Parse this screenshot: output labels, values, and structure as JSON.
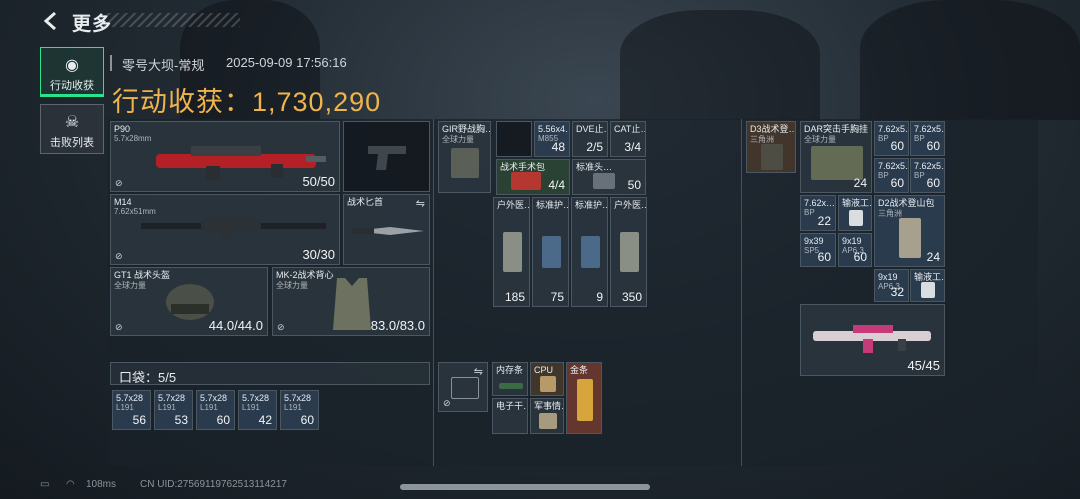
{
  "header": {
    "title": "更多"
  },
  "tabs": [
    {
      "label": "行动收获",
      "active": true,
      "icon": "loot-bag-icon"
    },
    {
      "label": "击败列表",
      "active": false,
      "icon": "skull-icon"
    }
  ],
  "raid": {
    "map": "零号大坝-常规",
    "datetime": "2025-09-09 17:56:16"
  },
  "harvest": {
    "label": "行动收获：",
    "value": "1,730,290"
  },
  "equipment": {
    "primary": {
      "name": "P90",
      "caliber": "5.7x28mm",
      "ammo": "50/50"
    },
    "secondary": {
      "name": "M14",
      "caliber": "7.62x51mm",
      "ammo": "30/30"
    },
    "pistol": {
      "name": ""
    },
    "melee": {
      "name": "战术匕首"
    },
    "helmet": {
      "name": "GT1 战术头盔",
      "brand": "全球力量",
      "durability": "44.0/44.0"
    },
    "armor": {
      "name": "MK-2战术背心",
      "brand": "全球力量",
      "durability": "83.0/83.0"
    }
  },
  "pockets": {
    "label": "口袋：5/5",
    "items": [
      {
        "name": "5.7x28",
        "sub": "L191",
        "count": "56"
      },
      {
        "name": "5.7x28",
        "sub": "L191",
        "count": "53"
      },
      {
        "name": "5.7x28",
        "sub": "L191",
        "count": "60"
      },
      {
        "name": "5.7x28",
        "sub": "L191",
        "count": "42"
      },
      {
        "name": "5.7x28",
        "sub": "L191",
        "count": "60"
      }
    ]
  },
  "chest_rig": {
    "name": "GIR野战胸…",
    "brand": "全球力量",
    "items": [
      {
        "name": "5.56x4…",
        "sub": "M855",
        "count": "48"
      },
      {
        "name": "DVE止…",
        "count": "2/5"
      },
      {
        "name": "CAT止…",
        "count": "3/4"
      },
      {
        "name": "战术手术包",
        "count": "4/4"
      },
      {
        "name": "标准头…",
        "count": "50"
      },
      {
        "name": "户外医…",
        "count": "185"
      },
      {
        "name": "标准护…",
        "count": "75"
      },
      {
        "name": "标准护…",
        "count": "9"
      },
      {
        "name": "户外医…",
        "count": "350"
      }
    ]
  },
  "safe_box": {
    "items": [
      {
        "name": "内存条"
      },
      {
        "name": "CPU"
      },
      {
        "name": "金条"
      },
      {
        "name": "电子干…"
      },
      {
        "name": "军事情…"
      }
    ]
  },
  "backpack": {
    "name": "D3战术登…",
    "brand": "三角洲",
    "items": [
      {
        "name": "DAR突击手胸挂",
        "brand": "全球力量",
        "count": "24"
      },
      {
        "name": "7.62x5…",
        "sub": "BP",
        "count": "60"
      },
      {
        "name": "7.62x5…",
        "sub": "BP",
        "count": "60"
      },
      {
        "name": "7.62x5…",
        "sub": "BP",
        "count": "60"
      },
      {
        "name": "7.62x5…",
        "sub": "BP",
        "count": "60"
      },
      {
        "name": "7.62x…",
        "sub": "BP",
        "count": "22"
      },
      {
        "name": "输液工…",
        "count": ""
      },
      {
        "name": "D2战术登山包",
        "brand": "三角洲",
        "count": "24"
      },
      {
        "name": "9x39",
        "sub": "SP5",
        "count": "60"
      },
      {
        "name": "9x19",
        "sub": "AP6.3",
        "count": "60"
      },
      {
        "name": "9x19",
        "sub": "AP6.3",
        "count": "32"
      },
      {
        "name": "输液工…",
        "count": ""
      },
      {
        "name": "",
        "count": "45/45"
      }
    ]
  },
  "footer": {
    "ping": "108ms",
    "uid": "CN UID:2756911976251311421​7"
  },
  "colors": {
    "accent": "#29e48a",
    "gold": "#f0b44c"
  }
}
